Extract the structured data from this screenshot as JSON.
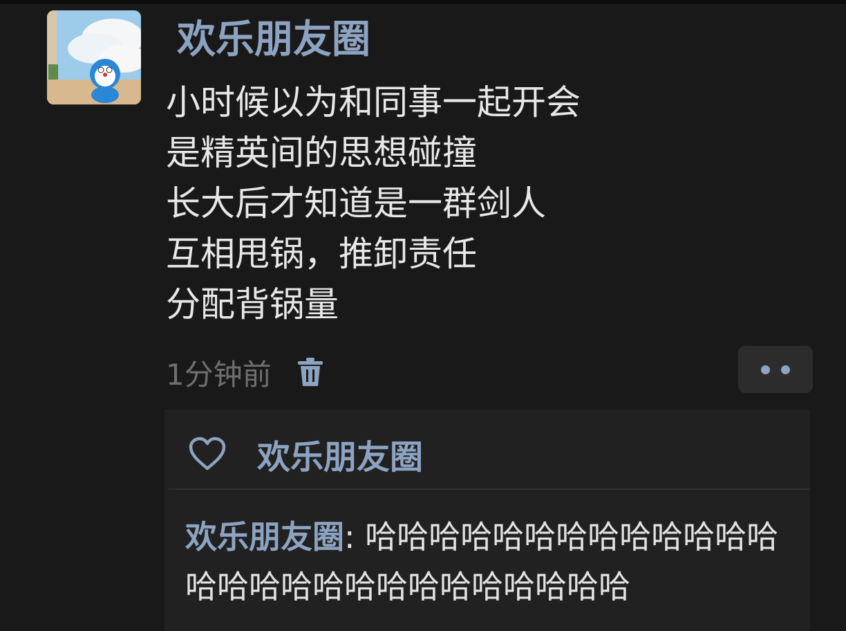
{
  "post": {
    "author": "欢乐朋友圈",
    "lines": [
      "小时候以为和同事一起开会",
      "是精英间的思想碰撞",
      "长大后才知道是一群剑人",
      "互相甩锅，推卸责任",
      "分配背锅量"
    ],
    "timestamp": "1分钟前"
  },
  "likes": {
    "names": "欢乐朋友圈"
  },
  "comments": [
    {
      "author": "欢乐朋友圈",
      "separator": ": ",
      "text": "哈哈哈哈哈哈哈哈哈哈哈哈哈哈哈哈哈哈哈哈哈哈哈哈哈哈哈"
    }
  ],
  "colors": {
    "background": "#191919",
    "name_link": "#8ca3c1",
    "text": "#e8e8e8",
    "timestamp": "#6f6f6f",
    "comment_panel": "#212121"
  },
  "icons": [
    "avatar",
    "trash-icon",
    "more-dots-icon",
    "heart-icon"
  ]
}
